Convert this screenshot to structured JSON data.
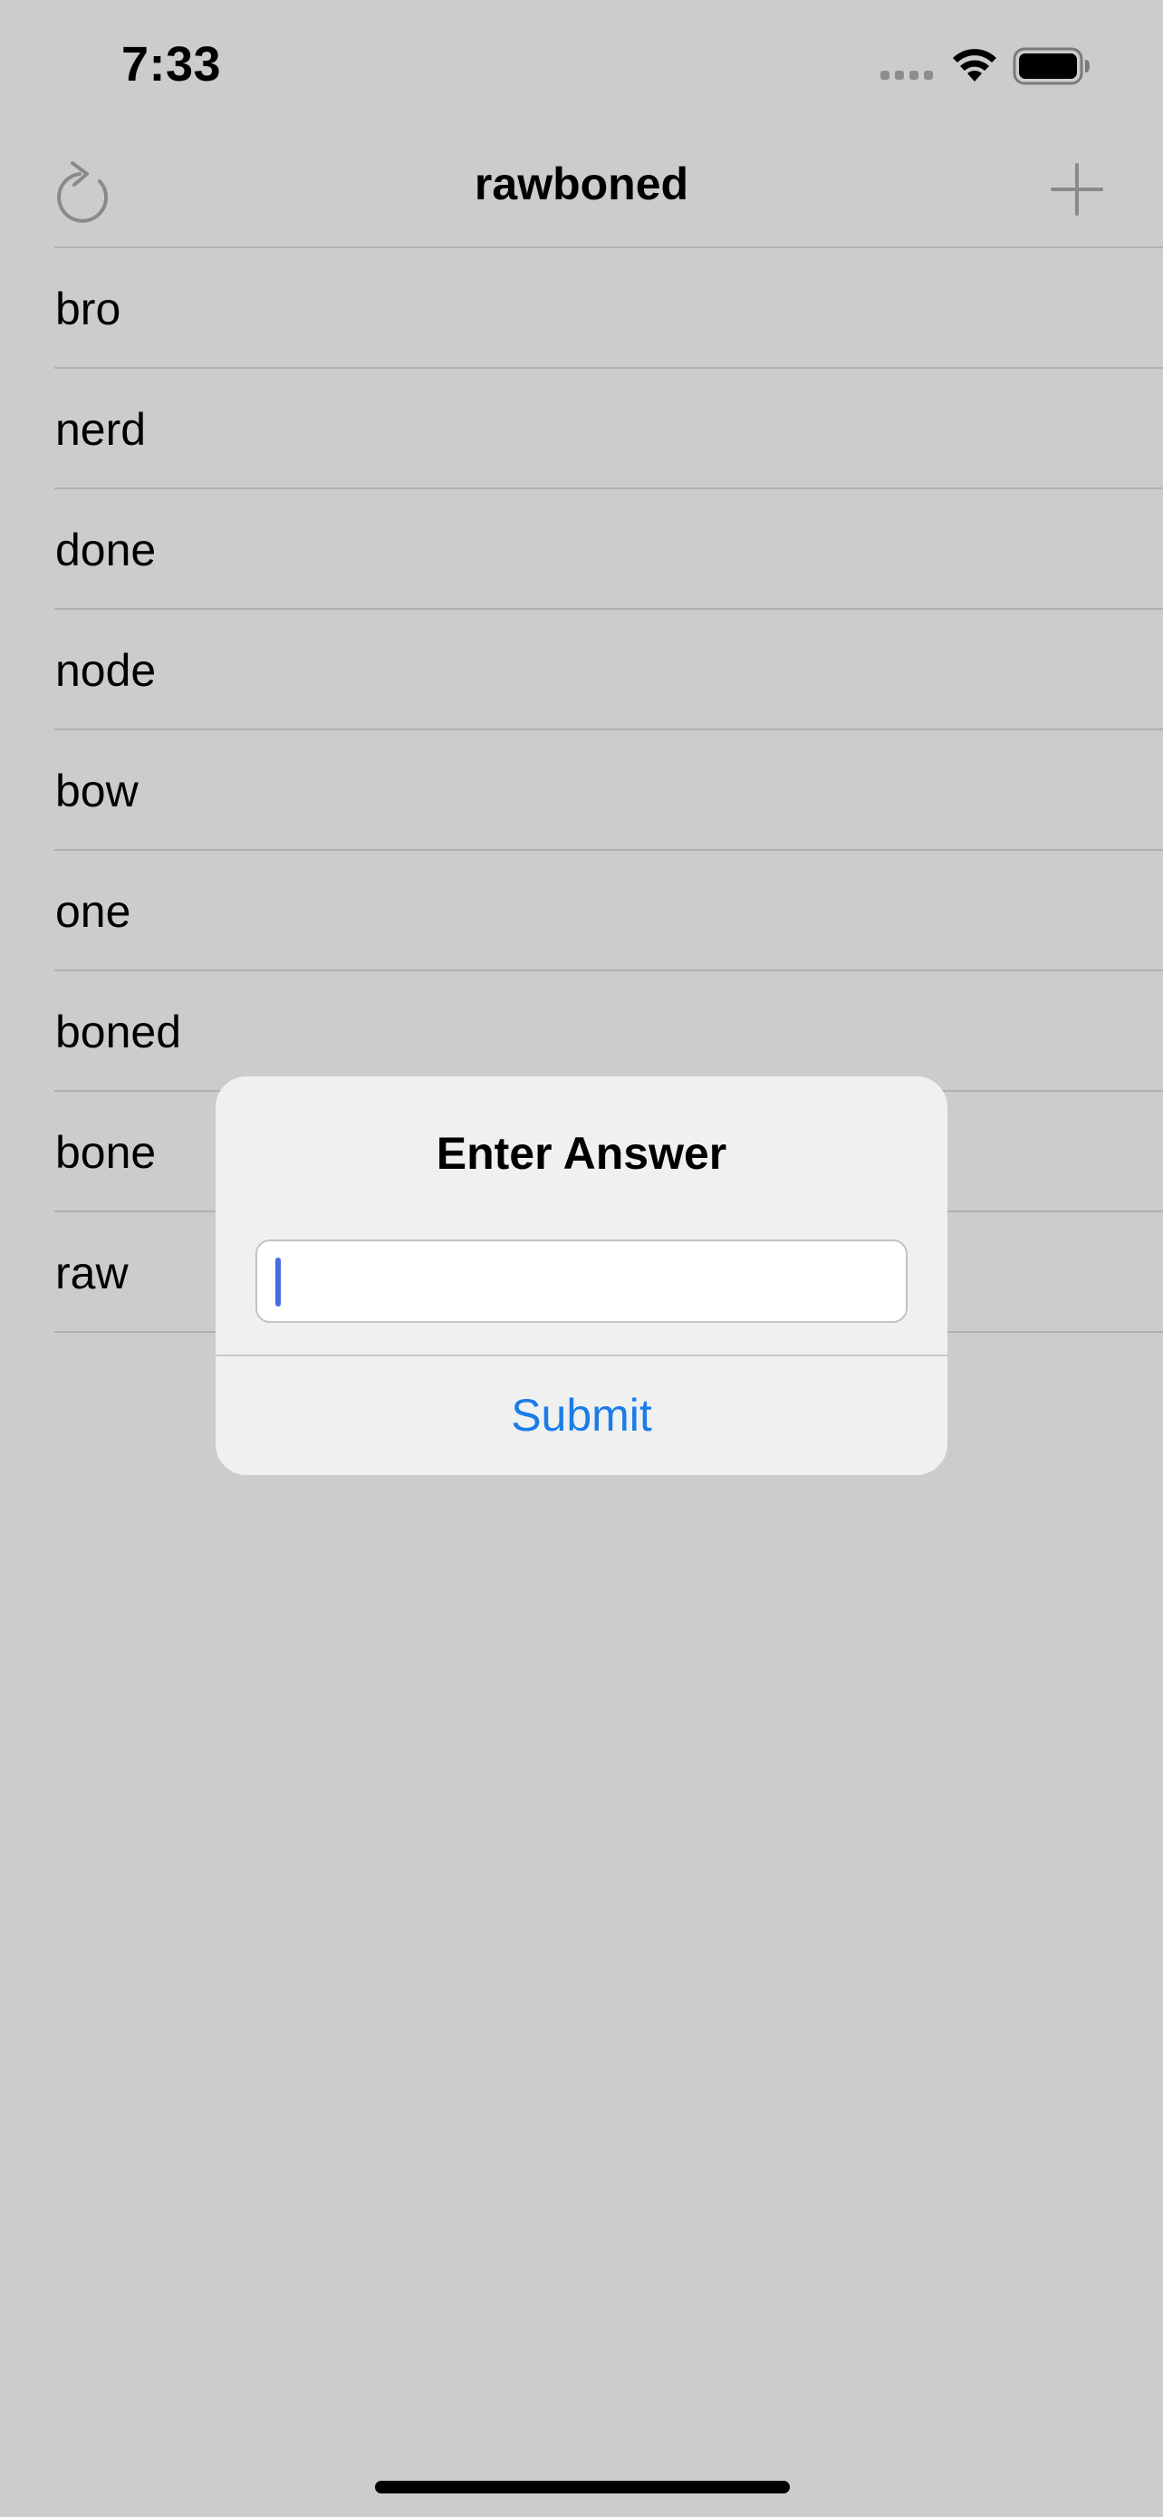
{
  "status_bar": {
    "time": "7:33",
    "icons": [
      "cellular-signal-icon",
      "wifi-icon",
      "battery-icon"
    ]
  },
  "nav": {
    "title": "rawboned",
    "left_icon": "refresh-icon",
    "right_icon": "plus-icon"
  },
  "words": [
    "bro",
    "nerd",
    "done",
    "node",
    "bow",
    "one",
    "boned",
    "bone",
    "raw"
  ],
  "alert": {
    "title": "Enter Answer",
    "input_value": "",
    "submit_label": "Submit"
  },
  "colors": {
    "background": "#cccccc",
    "alert_background": "#eff0f0",
    "accent": "#1a7ce8",
    "caret": "#4a6ae0",
    "icon_gray": "#8a8a8a"
  }
}
